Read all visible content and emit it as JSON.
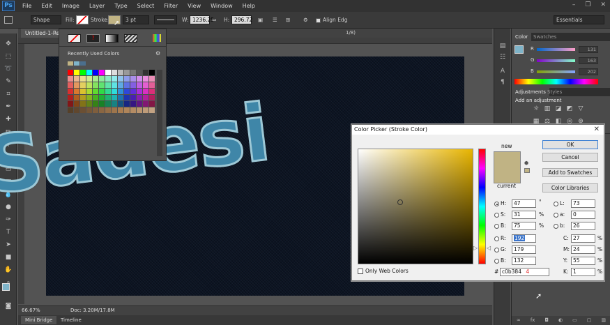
{
  "menubar": {
    "logo": "Ps",
    "items": [
      "File",
      "Edit",
      "Image",
      "Layer",
      "Type",
      "Select",
      "Filter",
      "View",
      "Window",
      "Help"
    ],
    "window_controls": [
      "–",
      "❐",
      "✕"
    ]
  },
  "options": {
    "mode": "Shape",
    "fill_label": "Fill:",
    "stroke_label": "Stroke:",
    "stroke_width": "3 pt",
    "w_label": "W:",
    "w_value": "1236.25",
    "h_label": "H:",
    "h_value": "296.72",
    "align_label": "Align Edg",
    "workspace": "Essentials"
  },
  "doc_tab": "Untitled-1-Reco",
  "doc_tab_suffix": "1/8)",
  "canvas": {
    "headline": "Sadesi"
  },
  "status": {
    "zoom": "66.67%",
    "doc": "Doc: 3.20M/17.8M"
  },
  "bottom_tabs": [
    "Mini Bridge",
    "Timeline"
  ],
  "swatch_popup": {
    "title": "Recently Used Colors"
  },
  "panels": {
    "color_tabs": [
      "Color",
      "Swatches"
    ],
    "channels": [
      {
        "label": "R",
        "value": "131"
      },
      {
        "label": "G",
        "value": "163"
      },
      {
        "label": "B",
        "value": "202"
      }
    ],
    "adj_tabs": [
      "Adjustments",
      "Styles"
    ],
    "adj_title": "Add an adjustment"
  },
  "picker": {
    "title": "Color Picker (Stroke Color)",
    "close": "✕",
    "new_label": "new",
    "current_label": "current",
    "buttons": {
      "ok": "OK",
      "cancel": "Cancel",
      "add": "Add to Swatches",
      "libraries": "Color Libraries"
    },
    "hsb": [
      {
        "label": "H:",
        "value": "47",
        "unit": "°"
      },
      {
        "label": "S:",
        "value": "31",
        "unit": "%"
      },
      {
        "label": "B:",
        "value": "75",
        "unit": "%"
      }
    ],
    "rgb": [
      {
        "label": "R:",
        "value": "192"
      },
      {
        "label": "G:",
        "value": "179"
      },
      {
        "label": "B:",
        "value": "132"
      }
    ],
    "lab": [
      {
        "label": "L:",
        "value": "73"
      },
      {
        "label": "a:",
        "value": "0"
      },
      {
        "label": "b:",
        "value": "26"
      }
    ],
    "cmyk": [
      {
        "label": "C:",
        "value": "27",
        "unit": "%"
      },
      {
        "label": "M:",
        "value": "24",
        "unit": "%"
      },
      {
        "label": "Y:",
        "value": "55",
        "unit": "%"
      },
      {
        "label": "K:",
        "value": "1",
        "unit": "%"
      }
    ],
    "hash": "#",
    "hex": "c0b384",
    "annotation": "4",
    "web_only": "Only Web Colors",
    "new_color": "#c0b384",
    "current_color": "#c0b384"
  }
}
